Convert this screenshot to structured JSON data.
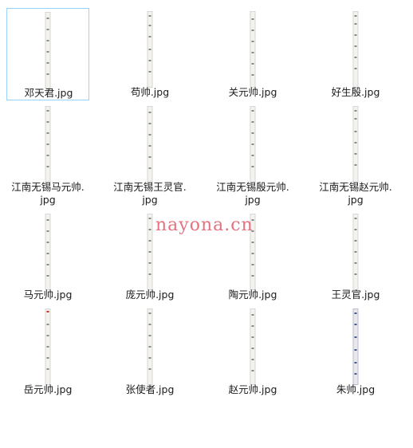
{
  "files": [
    {
      "name": "邓天君.jpg",
      "selected": true
    },
    {
      "name": "苟帅.jpg"
    },
    {
      "name": "关元帅.jpg"
    },
    {
      "name": "好生殷.jpg"
    },
    {
      "name": "江南无锡马元帅.\njpg"
    },
    {
      "name": "江南无锡王灵官.\njpg"
    },
    {
      "name": "江南无锡殷元帅.\njpg"
    },
    {
      "name": "江南无锡赵元帅.\njpg"
    },
    {
      "name": "马元帅.jpg"
    },
    {
      "name": "庞元帅.jpg"
    },
    {
      "name": "陶元帅.jpg"
    },
    {
      "name": "王灵官.jpg"
    },
    {
      "name": "岳元帅.jpg"
    },
    {
      "name": "张使者.jpg"
    },
    {
      "name": "赵元帅.jpg"
    },
    {
      "name": "朱帅.jpg"
    }
  ],
  "watermark": "nayona.cn"
}
